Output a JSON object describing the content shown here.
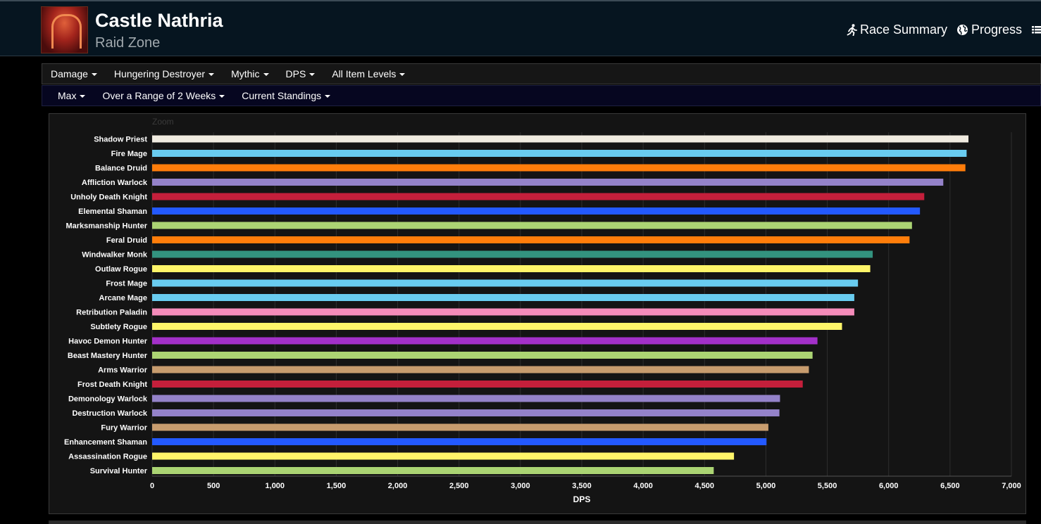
{
  "header": {
    "title": "Castle Nathria",
    "subtitle": "Raid Zone",
    "links": [
      {
        "label": "Race Summary",
        "icon": "running-icon"
      },
      {
        "label": "Progress",
        "icon": "globe-icon"
      }
    ],
    "overflow_icon": "list-icon"
  },
  "filters": {
    "row1": [
      "Damage",
      "Hungering Destroyer",
      "Mythic",
      "DPS",
      "All Item Levels"
    ],
    "row2": [
      "Max",
      "Over a Range of 2 Weeks",
      "Current Standings"
    ]
  },
  "chart": {
    "zoom_label": "Zoom"
  },
  "chart_data": {
    "type": "bar",
    "orientation": "horizontal",
    "xlabel": "DPS",
    "xlim": [
      0,
      7000
    ],
    "xticks": [
      0,
      500,
      1000,
      1500,
      2000,
      2500,
      3000,
      3500,
      4000,
      4500,
      5000,
      5500,
      6000,
      6500,
      7000
    ],
    "xtick_labels": [
      "0",
      "500",
      "1,000",
      "1,500",
      "2,000",
      "2,500",
      "3,000",
      "3,500",
      "4,000",
      "4,500",
      "5,000",
      "5,500",
      "6,000",
      "6,500",
      "7,000"
    ],
    "grid": true,
    "categories": [
      "Shadow Priest",
      "Fire Mage",
      "Balance Druid",
      "Affliction Warlock",
      "Unholy Death Knight",
      "Elemental Shaman",
      "Marksmanship Hunter",
      "Feral Druid",
      "Windwalker Monk",
      "Outlaw Rogue",
      "Frost Mage",
      "Arcane Mage",
      "Retribution Paladin",
      "Subtlety Rogue",
      "Havoc Demon Hunter",
      "Beast Mastery Hunter",
      "Arms Warrior",
      "Frost Death Knight",
      "Demonology Warlock",
      "Destruction Warlock",
      "Fury Warrior",
      "Enhancement Shaman",
      "Assassination Rogue",
      "Survival Hunter"
    ],
    "values": [
      6650,
      6635,
      6625,
      6445,
      6290,
      6255,
      6190,
      6170,
      5870,
      5850,
      5750,
      5720,
      5720,
      5620,
      5420,
      5380,
      5350,
      5300,
      5115,
      5110,
      5020,
      5005,
      4740,
      4575
    ],
    "colors": [
      "#F0EBE0",
      "#69CCF0",
      "#FF7D0A",
      "#9482C9",
      "#C41F3B",
      "#2359FF",
      "#ABD473",
      "#FF7D0A",
      "#33937F",
      "#FFF569",
      "#69CCF0",
      "#69CCF0",
      "#F58CBA",
      "#FFF569",
      "#A330C9",
      "#ABD473",
      "#C79C6E",
      "#C41F3B",
      "#9482C9",
      "#9482C9",
      "#C79C6E",
      "#2359FF",
      "#FFF569",
      "#ABD473"
    ]
  }
}
